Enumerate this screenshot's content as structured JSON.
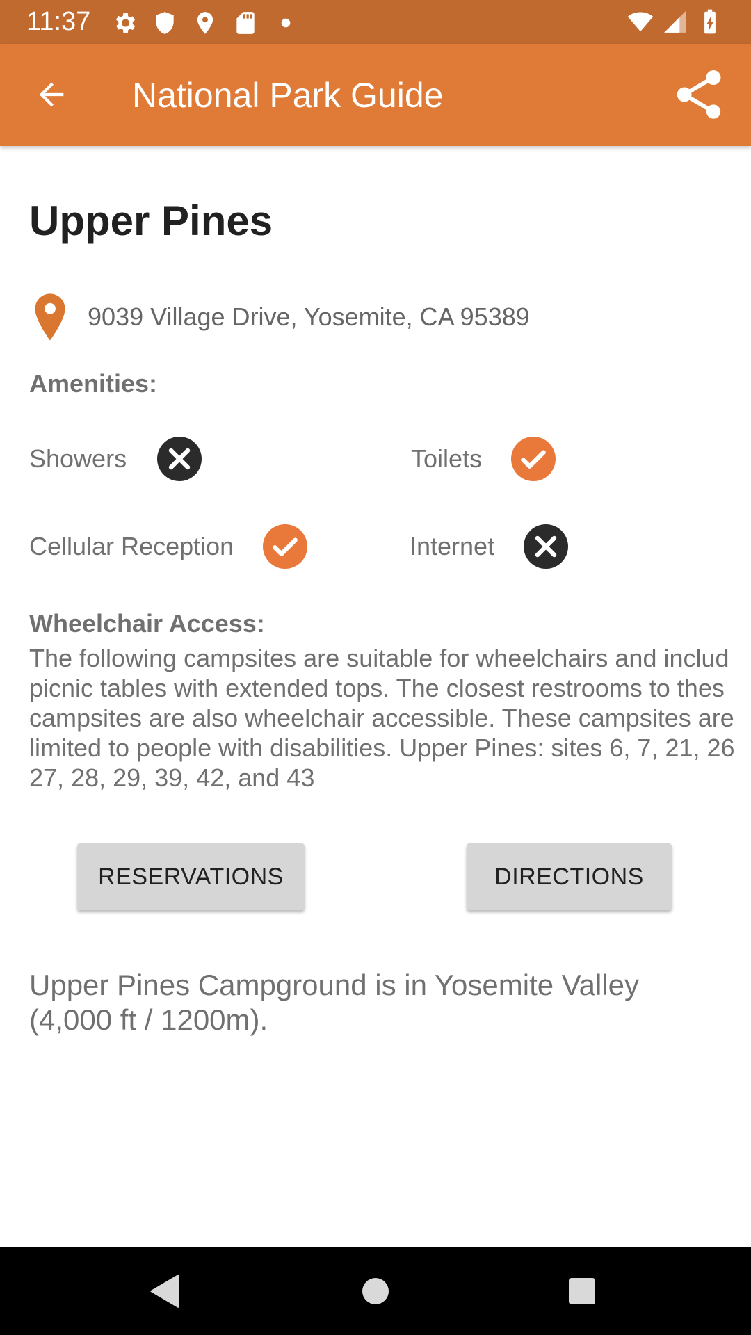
{
  "status_bar": {
    "time": "11:37",
    "left_icons": [
      "settings-icon",
      "shield-icon",
      "location-icon",
      "sd-card-icon",
      "dot-icon"
    ],
    "right_icons": [
      "wifi-icon",
      "signal-icon",
      "battery-charging-icon"
    ]
  },
  "app_bar": {
    "title": "National Park Guide",
    "back_icon": "arrow-back-icon",
    "share_icon": "share-icon",
    "background": "#E07B37",
    "status_background": "#C06A30"
  },
  "campground": {
    "name": "Upper Pines",
    "address": "9039 Village Drive, Yosemite, CA 95389",
    "pin_color": "#D9762F"
  },
  "amenities": {
    "label": "Amenities:",
    "items": [
      {
        "label": "Showers",
        "available": false
      },
      {
        "label": "Toilets",
        "available": true
      },
      {
        "label": "Cellular Reception",
        "available": true
      },
      {
        "label": "Internet",
        "available": false
      }
    ],
    "yes_color": "#E9793A",
    "no_color": "#2B2B2B"
  },
  "wheelchair": {
    "label": "Wheelchair Access:",
    "lines": [
      "The following campsites are suitable for wheelchairs and includ",
      "picnic tables with extended tops. The closest restrooms to thes",
      "campsites are also wheelchair accessible. These campsites are",
      "limited to people with disabilities. Upper Pines: sites 6, 7, 21, 26",
      "27, 28, 29, 39, 42, and 43"
    ]
  },
  "buttons": {
    "reservations": "RESERVATIONS",
    "directions": "DIRECTIONS"
  },
  "description": "Upper Pines Campground is in Yosemite Valley (4,000 ft / 1200m).",
  "nav_bar": {
    "back": "nav-back-icon",
    "home": "nav-home-icon",
    "recents": "nav-recents-icon"
  }
}
